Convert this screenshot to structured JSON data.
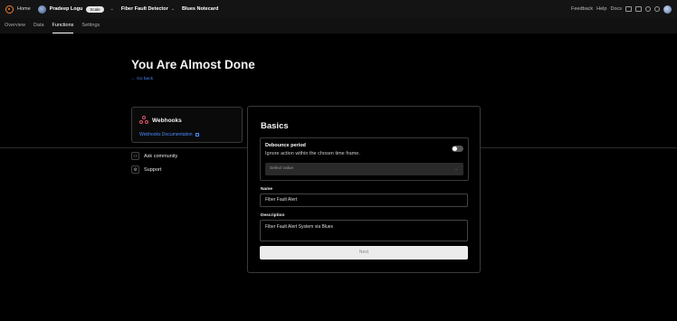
{
  "topbar": {
    "home": "Home",
    "user": "Pradeep Logu",
    "plan": "Scale",
    "project": "Fiber Fault Detector",
    "product": "Blues Notecard",
    "links": [
      "Feedback",
      "Help",
      "Docs"
    ]
  },
  "tabs": [
    {
      "label": "Overview",
      "active": false
    },
    {
      "label": "Data",
      "active": false
    },
    {
      "label": "Functions",
      "active": true
    },
    {
      "label": "Settings",
      "active": false
    }
  ],
  "page": {
    "title": "You Are Almost Done",
    "go_back": "← Go back"
  },
  "webhooks": {
    "title": "Webhooks",
    "doc_link": "Webhooks Documentation"
  },
  "side_links": {
    "community": "Ask community",
    "support": "Support"
  },
  "basics": {
    "title": "Basics",
    "debounce_label": "Debounce period",
    "debounce_help": "Ignore action within the chosen time frame.",
    "debounce_enabled": false,
    "select_placeholder": "Select value",
    "name_label": "Name",
    "name_value": "Fiber Fault Alert",
    "description_label": "Description",
    "description_value": "Fiber Fault Alert System via Blues",
    "next_label": "Next"
  }
}
